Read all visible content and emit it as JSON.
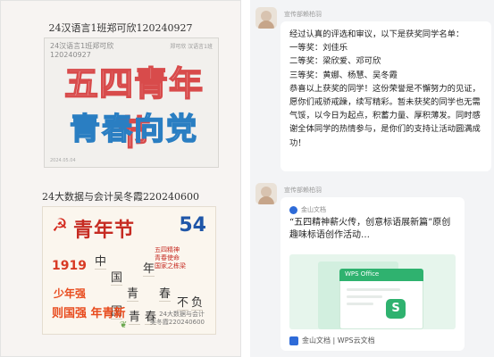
{
  "left": {
    "caption1": "24汉语言1班郑可欣120240927",
    "poster1": {
      "watermark": "24汉语言1班郑可欣\n120240927",
      "top_tag": "郑可欣 汉语言1班",
      "line1": "五四青年节",
      "line2": "青春向党",
      "corner": "2024.05.04"
    },
    "caption2": "24大数据与会计吴冬霞220240600",
    "poster2": {
      "hammer": "☭",
      "title": "青年节",
      "number": "54",
      "year": "1919",
      "grid_chars": [
        "中",
        "国",
        "青",
        "年",
        "春",
        "国",
        "青",
        "春",
        "不",
        "负"
      ],
      "slogan1": "少年强",
      "slogan2": "则国强 年青新",
      "red_note": "五四精神\n青春使命\n国家之栋梁",
      "stamp": "24大数据与会计\n吴冬霞220240600"
    }
  },
  "chat": {
    "msg1": {
      "sender": "宣传部赖柏羽",
      "text": "经过认真的评选和审议，以下是获奖同学名单：\n一等奖：刘佳乐\n二等奖：梁欣爱、邓可欣\n三等奖：黄娜、杨慧、吴冬霞\n恭喜以上获奖的同学！这份荣誉是不懈努力的见证，愿你们戒骄戒躁，续写精彩。暂未获奖的同学也无需气馁，以今日为起点，积蓄力量、厚积薄发。同时感谢全体同学的热情参与，是你们的支持让活动圆满成功！"
    },
    "msg2": {
      "sender": "宣传部赖柏羽",
      "source": "金山文档",
      "title": "“五四精神薪火传，创意标语展新篇”原创趣味标语创作活动…",
      "wps_label": "WPS Office",
      "s_badge": "S",
      "footer": "金山文档 | WPS云文档"
    }
  }
}
